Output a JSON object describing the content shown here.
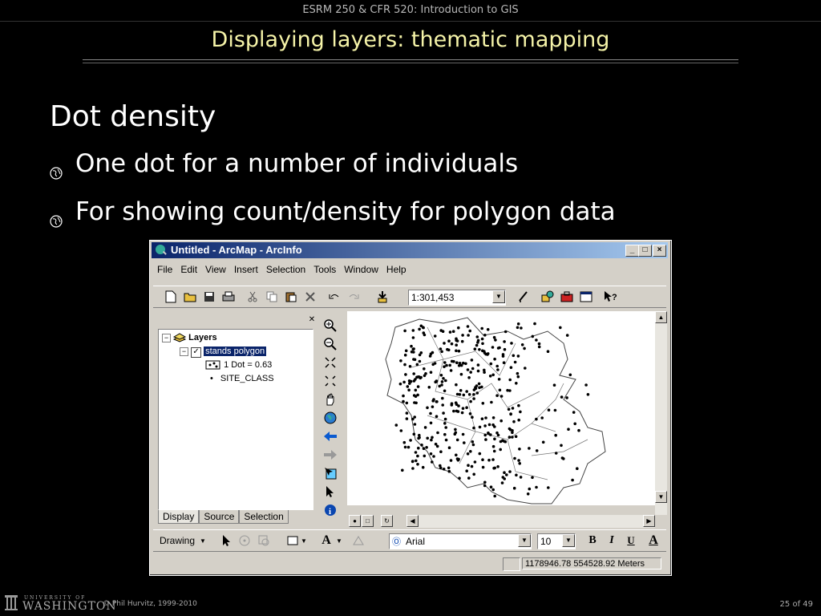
{
  "slide": {
    "course_header": "ESRM 250 & CFR 520: Introduction to GIS",
    "title": "Displaying layers: thematic mapping",
    "heading": "Dot density",
    "bullets": [
      "One dot for a number of individuals",
      "For showing count/density for polygon data"
    ],
    "footer": {
      "logo_top": "UNIVERSITY OF",
      "logo_bottom": "WASHINGTON",
      "copyright": "© Phil Hurvitz, 1999-2010",
      "page": "25 of 49"
    }
  },
  "window": {
    "title": "Untitled - ArcMap - ArcInfo",
    "controls": [
      "_",
      "□",
      "×"
    ],
    "menu": [
      "File",
      "Edit",
      "View",
      "Insert",
      "Selection",
      "Tools",
      "Window",
      "Help"
    ],
    "scale": "1:301,453",
    "toc": {
      "root": "Layers",
      "layer": "stands polygon",
      "legend_dot": "1 Dot = 0.63",
      "legend_field": "SITE_CLASS",
      "tabs": [
        "Display",
        "Source",
        "Selection"
      ]
    },
    "drawing_toolbar": {
      "drawing_label": "Drawing",
      "font": "Arial",
      "font_size": "10",
      "bold": "B",
      "italic": "I",
      "underline": "U"
    },
    "status": {
      "coordinates": "1178946.78  554528.92 Meters"
    }
  },
  "colors": {
    "title_yellow": "#f5f3a8",
    "titlebar_start": "#0a246a",
    "titlebar_end": "#a6caf0",
    "selection": "#0a246a"
  }
}
